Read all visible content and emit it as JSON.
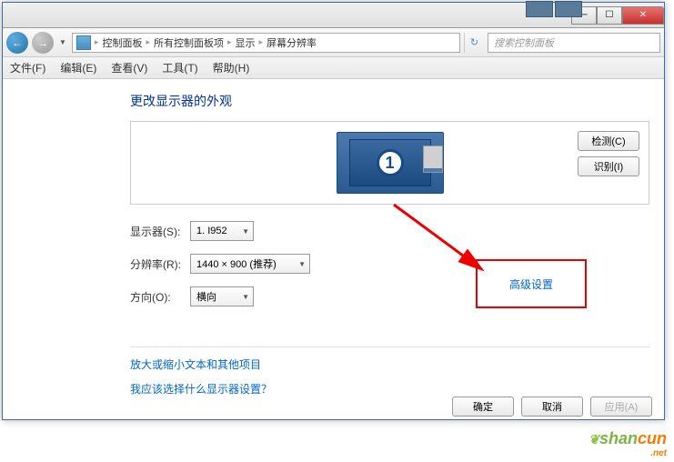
{
  "titlebar": {
    "minimize": "─",
    "maximize": "☐",
    "close": "✕"
  },
  "nav": {
    "back": "←",
    "forward": "→",
    "breadcrumb": [
      "控制面板",
      "所有控制面板项",
      "显示",
      "屏幕分辨率"
    ],
    "refresh": "↻",
    "search_placeholder": "搜索控制面板"
  },
  "menu": {
    "file": "文件(F)",
    "edit": "编辑(E)",
    "view": "查看(V)",
    "tools": "工具(T)",
    "help": "帮助(H)"
  },
  "heading": "更改显示器的外观",
  "monitor": {
    "number": "1",
    "detect": "检测(C)",
    "identify": "识别(I)"
  },
  "form": {
    "display_label": "显示器(S):",
    "display_value": "1. I952",
    "resolution_label": "分辨率(R):",
    "resolution_value": "1440 × 900 (推荐)",
    "orientation_label": "方向(O):",
    "orientation_value": "横向"
  },
  "links": {
    "advanced": "高级设置",
    "text_size": "放大或缩小文本和其他项目",
    "which_settings": "我应该选择什么显示器设置？"
  },
  "footer": {
    "ok": "确定",
    "cancel": "取消",
    "apply": "应用(A)"
  },
  "watermark": {
    "part1": "shan",
    "part2": "cun",
    "net": ".net"
  }
}
